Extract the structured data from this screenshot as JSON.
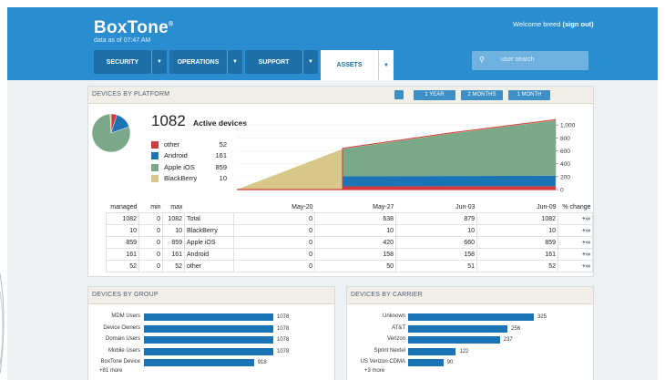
{
  "header": {
    "brand": "BoxTone",
    "as_of": "data as of 07:47 AM",
    "welcome": "Welcome breed",
    "signout": "(sign out)"
  },
  "nav": [
    {
      "label": "SECURITY",
      "active": false
    },
    {
      "label": "OPERATIONS",
      "active": false
    },
    {
      "label": "SUPPORT",
      "active": false
    },
    {
      "label": "ASSETS",
      "active": true
    }
  ],
  "search": {
    "placeholder": "user search"
  },
  "platform": {
    "title": "DEVICES BY PLATFORM",
    "ranges": [
      "1 YEAR",
      "2 MONTHS",
      "1 MONTH"
    ],
    "total": "1082",
    "total_label": "Active devices",
    "legend": [
      {
        "name": "other",
        "value": "52",
        "color": "#d23a3a"
      },
      {
        "name": "Android",
        "value": "161",
        "color": "#1a73b5"
      },
      {
        "name": "Apple iOS",
        "value": "859",
        "color": "#7aa888"
      },
      {
        "name": "BlackBerry",
        "value": "10",
        "color": "#d8c98a"
      }
    ],
    "chart_data": {
      "type": "area",
      "x": [
        "May-20",
        "May-27",
        "Jun-03",
        "Jun-09"
      ],
      "yticks": [
        "1,000",
        "800",
        "600",
        "400",
        "200",
        "0"
      ],
      "ylim": [
        0,
        1100
      ],
      "series": [
        {
          "name": "other",
          "values": [
            0,
            50,
            51,
            52
          ],
          "color": "#d23a3a"
        },
        {
          "name": "Android",
          "values": [
            0,
            158,
            158,
            161
          ],
          "color": "#1a73b5"
        },
        {
          "name": "Apple iOS",
          "values": [
            0,
            420,
            660,
            859
          ],
          "color": "#7aa888"
        },
        {
          "name": "BlackBerry",
          "values": [
            0,
            10,
            10,
            10
          ],
          "color": "#d8c98a"
        }
      ]
    },
    "table": {
      "headers": [
        "managed",
        "min",
        "max",
        "",
        "May-20",
        "May-27",
        "Jun-03",
        "Jun-09",
        "% change"
      ],
      "rows": [
        [
          "1082",
          "0",
          "1082",
          "Total",
          "0",
          "638",
          "879",
          "1082",
          "+∞"
        ],
        [
          "10",
          "0",
          "10",
          "BlackBerry",
          "0",
          "10",
          "10",
          "10",
          "+∞"
        ],
        [
          "859",
          "0",
          "859",
          "Apple iOS",
          "0",
          "420",
          "660",
          "859",
          "+∞"
        ],
        [
          "161",
          "0",
          "161",
          "Android",
          "0",
          "158",
          "158",
          "161",
          "+∞"
        ],
        [
          "52",
          "0",
          "52",
          "other",
          "0",
          "50",
          "51",
          "52",
          "+∞"
        ]
      ]
    }
  },
  "group": {
    "title": "DEVICES BY GROUP",
    "rows": [
      {
        "label": "MDM Users",
        "value": "1078",
        "frac": 1.0
      },
      {
        "label": "Device Owners",
        "value": "1078",
        "frac": 1.0
      },
      {
        "label": "Domain Users",
        "value": "1078",
        "frac": 1.0
      },
      {
        "label": "Mobile Users",
        "value": "1078",
        "frac": 1.0
      },
      {
        "label": "BoxTone Device",
        "value": "918",
        "frac": 0.85
      }
    ],
    "more": "+81 more"
  },
  "carrier": {
    "title": "DEVICES BY CARRIER",
    "rows": [
      {
        "label": "Unknown",
        "value": "325",
        "frac": 1.0
      },
      {
        "label": "AT&T",
        "value": "256",
        "frac": 0.79
      },
      {
        "label": "Verizon",
        "value": "237",
        "frac": 0.73
      },
      {
        "label": "Sprint Nextel",
        "value": "122",
        "frac": 0.38
      },
      {
        "label": "US Verizon CDMA",
        "value": "90",
        "frac": 0.28
      }
    ],
    "more": "+3 more"
  }
}
